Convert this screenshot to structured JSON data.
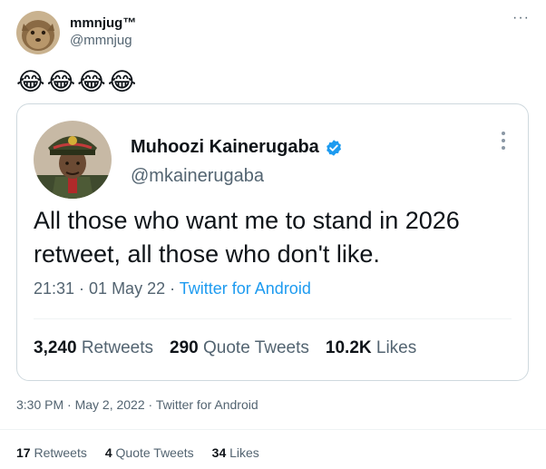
{
  "tweet": {
    "author_name": "mmnjug™",
    "author_handle": "@mmnjug",
    "more_label": "···",
    "emojis": [
      "😂",
      "😂",
      "😂",
      "😂"
    ],
    "timestamp": "3:30 PM · May 2, 2022 · Twitter for Android",
    "stats": {
      "retweets_count": "17",
      "retweets_label": "Retweets",
      "quotes_count": "4",
      "quotes_label": "Quote Tweets",
      "likes_count": "34",
      "likes_label": "Likes"
    }
  },
  "quoted": {
    "author_name": "Muhoozi Kainerugaba",
    "author_handle": "@mkainerugaba",
    "verified": true,
    "text": "All those who want me to stand in 2026 retweet, all those who don't like.",
    "time": "21:31 · 01 May 22 · ",
    "source": "Twitter for Android",
    "stats": {
      "retweets_count": "3,240",
      "retweets_label": "Retweets",
      "quotes_count": "290",
      "quotes_label": "Quote Tweets",
      "likes_count": "10.2K",
      "likes_label": "Likes"
    }
  },
  "colors": {
    "verified_blue": "#1d9bf0",
    "secondary_text": "#536471",
    "border": "#cfd9de"
  }
}
